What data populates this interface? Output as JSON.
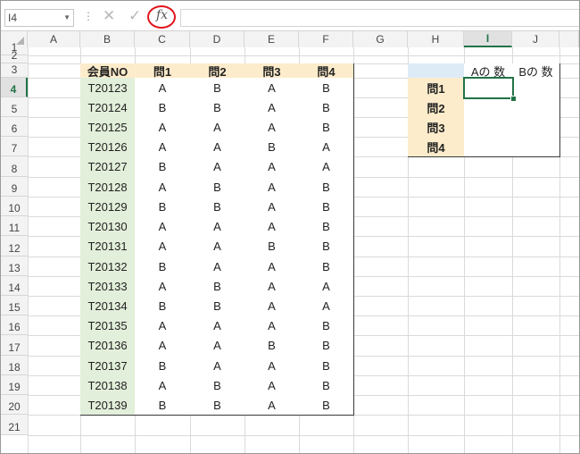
{
  "formula_bar": {
    "name_box": "I4",
    "fx_label": "fx",
    "cancel_icon": "✕",
    "enter_icon": "✓",
    "dots": "⋮",
    "formula": ""
  },
  "columns": [
    "A",
    "B",
    "C",
    "D",
    "E",
    "F",
    "G",
    "H",
    "I",
    "J"
  ],
  "rows": [
    "1",
    "2",
    "3",
    "4",
    "5",
    "6",
    "7",
    "8",
    "9",
    "10",
    "11",
    "12",
    "13",
    "14",
    "15",
    "16",
    "17",
    "18",
    "19",
    "20",
    "21"
  ],
  "selected": {
    "cell": "I4",
    "column": "I",
    "row": "4"
  },
  "colors": {
    "accent": "#217346",
    "header_fill": "#fdeccb",
    "id_fill": "#e2efda",
    "blank_header_fill": "#ddebf7",
    "fx_highlight": "#e0161c"
  },
  "main_table": {
    "headers": [
      "会員NO",
      "問1",
      "問2",
      "問3",
      "問4"
    ],
    "rows": [
      [
        "T20123",
        "A",
        "B",
        "A",
        "B"
      ],
      [
        "T20124",
        "B",
        "B",
        "A",
        "B"
      ],
      [
        "T20125",
        "A",
        "A",
        "A",
        "B"
      ],
      [
        "T20126",
        "A",
        "A",
        "B",
        "A"
      ],
      [
        "T20127",
        "B",
        "A",
        "A",
        "A"
      ],
      [
        "T20128",
        "A",
        "B",
        "A",
        "B"
      ],
      [
        "T20129",
        "B",
        "B",
        "A",
        "B"
      ],
      [
        "T20130",
        "A",
        "A",
        "A",
        "B"
      ],
      [
        "T20131",
        "A",
        "A",
        "B",
        "B"
      ],
      [
        "T20132",
        "B",
        "A",
        "A",
        "B"
      ],
      [
        "T20133",
        "A",
        "B",
        "A",
        "A"
      ],
      [
        "T20134",
        "B",
        "B",
        "A",
        "A"
      ],
      [
        "T20135",
        "A",
        "A",
        "A",
        "B"
      ],
      [
        "T20136",
        "A",
        "A",
        "B",
        "B"
      ],
      [
        "T20137",
        "B",
        "A",
        "A",
        "B"
      ],
      [
        "T20138",
        "A",
        "B",
        "A",
        "B"
      ],
      [
        "T20139",
        "B",
        "B",
        "A",
        "B"
      ]
    ]
  },
  "summary_table": {
    "headers": [
      "",
      "Aの 数",
      "Bの 数"
    ],
    "rows": [
      [
        "問1",
        "",
        ""
      ],
      [
        "問2",
        "",
        ""
      ],
      [
        "問3",
        "",
        ""
      ],
      [
        "問4",
        "",
        ""
      ]
    ]
  }
}
